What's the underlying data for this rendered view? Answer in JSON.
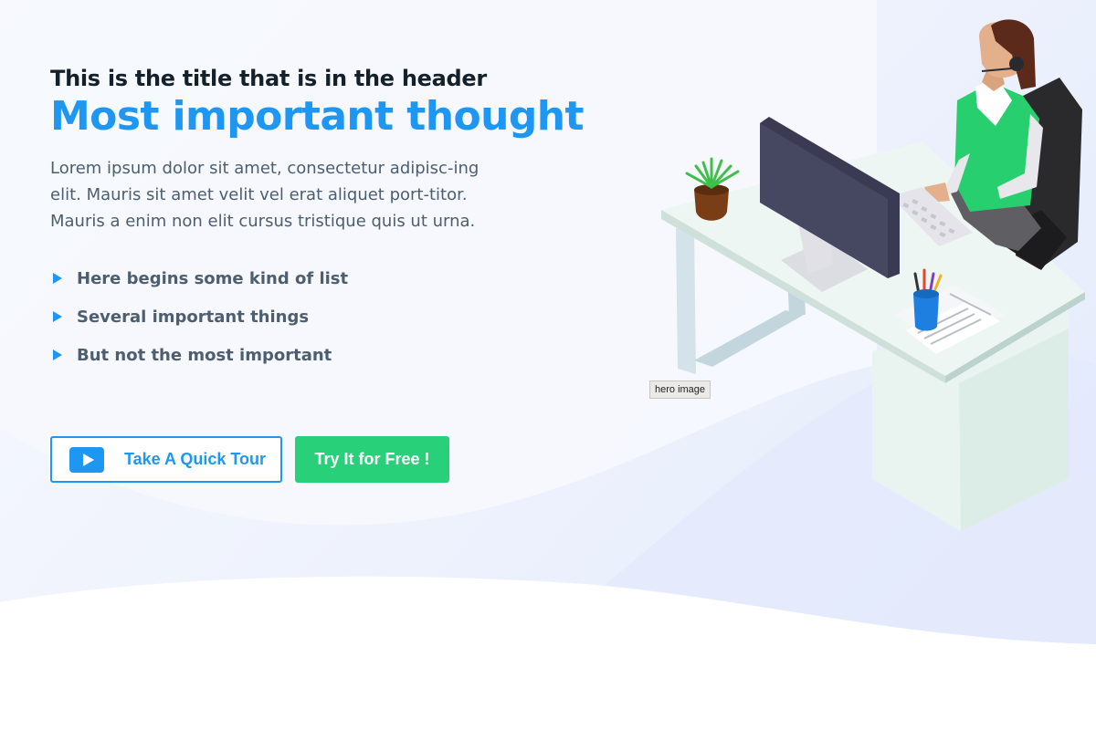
{
  "hero": {
    "header_title": "This is the title that is in the header",
    "main_thought": "Most important thought",
    "lead_text": "Lorem ipsum dolor sit amet, consectetur adipisc-ing elit. Mauris sit amet velit vel erat aliquet port-titor. Mauris a enim non elit cursus tristique quis ut urna.",
    "list_items": [
      "Here begins some kind of list",
      "Several important things",
      "But not the most important"
    ],
    "tour_button_label": "Take A Quick Tour",
    "free_button_label": "Try It for Free !",
    "image_tooltip": "hero image",
    "image_alt": "hero image"
  },
  "icons": {
    "bullet": "triangle-right-icon",
    "tour": "play-icon"
  },
  "colors": {
    "accent_blue": "#1e97f2",
    "accent_green": "#27d079",
    "title_dark": "#14202b",
    "body_text": "#4c5e70",
    "bg_tint": "#eef2fd"
  }
}
